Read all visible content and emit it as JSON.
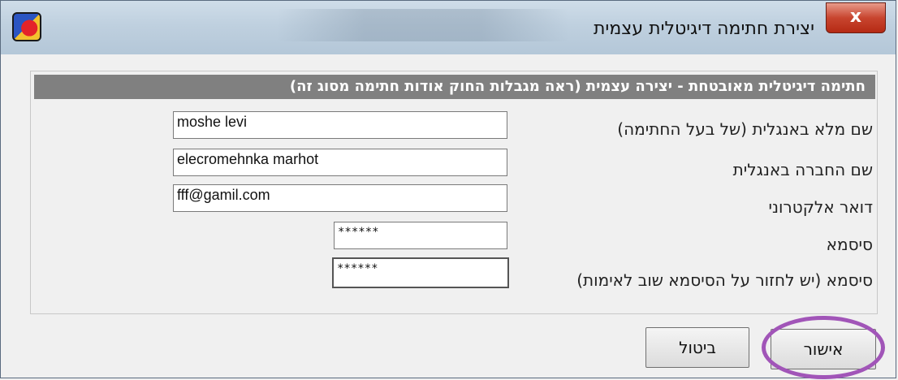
{
  "window": {
    "title": "יצירת חתימה דיגיטלית עצמית",
    "close_glyph": "x"
  },
  "panel": {
    "header": "חתימה דיגיטלית מאובטחת - יצירה עצמית (ראה מגבלות החוק אודות חתימה מסוג זה)"
  },
  "form": {
    "full_name": {
      "label": "שם מלא באנגלית (של בעל החתימה)",
      "value": "moshe levi"
    },
    "company": {
      "label": "שם החברה באנגלית",
      "value": "elecromehnka marhot"
    },
    "email": {
      "label": "דואר אלקטרוני",
      "value": "fff@gamil.com"
    },
    "password": {
      "label": "סיסמא",
      "value": "******"
    },
    "password_confirm": {
      "label": "סיסמא (יש לחזור על הסיסמא שוב לאימות)",
      "value": "******"
    }
  },
  "buttons": {
    "ok": "אישור",
    "cancel": "ביטול"
  },
  "colors": {
    "header_bg": "#808080",
    "highlight_ring": "#a155b8",
    "close_red": "#c8452f"
  },
  "icons": {
    "app": "app-logo-icon",
    "close": "close-icon"
  }
}
